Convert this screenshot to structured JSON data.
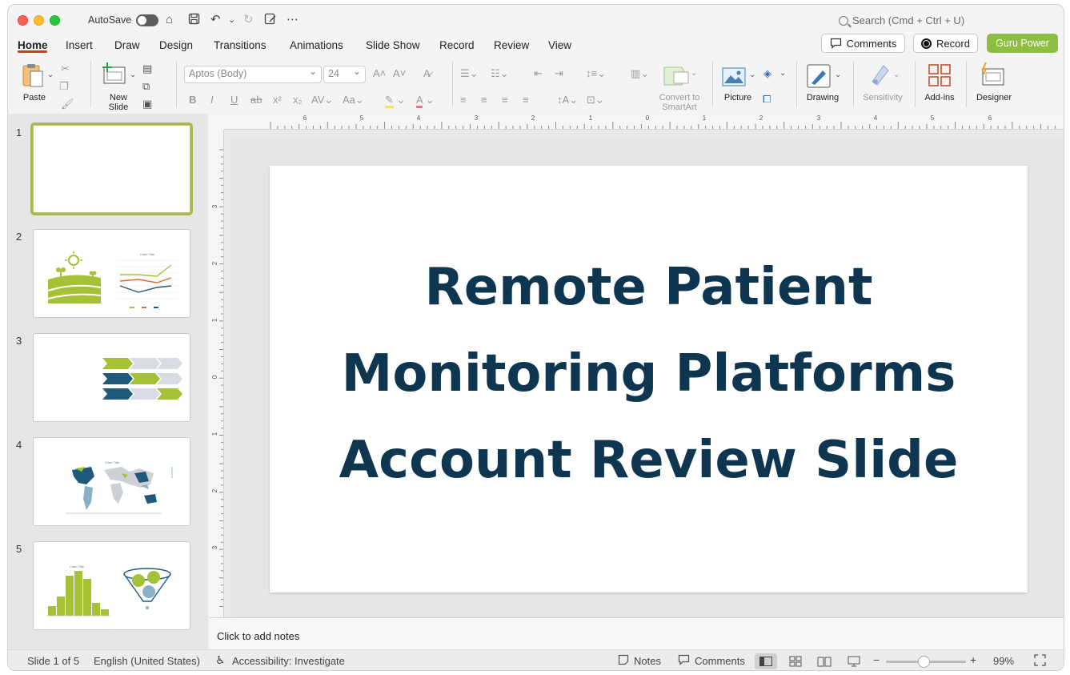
{
  "titlebar": {
    "autosave_label": "AutoSave",
    "search_placeholder": "Search (Cmd + Ctrl + U)"
  },
  "tabs": [
    {
      "label": "Home"
    },
    {
      "label": "Insert"
    },
    {
      "label": "Draw"
    },
    {
      "label": "Design"
    },
    {
      "label": "Transitions"
    },
    {
      "label": "Animations"
    },
    {
      "label": "Slide Show"
    },
    {
      "label": "Record"
    },
    {
      "label": "Review"
    },
    {
      "label": "View"
    }
  ],
  "header_buttons": {
    "comments": "Comments",
    "record": "Record",
    "guru": "Guru Power"
  },
  "ribbon": {
    "paste": "Paste",
    "new_slide_1": "New",
    "new_slide_2": "Slide",
    "font_name": "Aptos (Body)",
    "font_size": "24",
    "convert_1": "Convert to",
    "convert_2": "SmartArt",
    "picture": "Picture",
    "drawing": "Drawing",
    "sensitivity": "Sensitivity",
    "addins": "Add-ins",
    "designer": "Designer"
  },
  "ruler": {
    "top": [
      "6",
      "5",
      "4",
      "3",
      "2",
      "1",
      "0",
      "1",
      "2",
      "3",
      "4",
      "5",
      "6"
    ],
    "left": [
      "3",
      "2",
      "1",
      "0",
      "1",
      "2",
      "3"
    ]
  },
  "thumbnails": [
    {
      "number": "1"
    },
    {
      "number": "2",
      "chart_title": "Chart Title"
    },
    {
      "number": "3"
    },
    {
      "number": "4",
      "chart_title": "Chart Title"
    },
    {
      "number": "5",
      "chart_title": "Chart Title"
    }
  ],
  "slide": {
    "title_line1": "Remote Patient",
    "title_line2": "Monitoring Platforms",
    "title_line3": "Account Review Slide"
  },
  "notes": {
    "placeholder": "Click to add notes"
  },
  "status": {
    "slide_count": "Slide 1 of 5",
    "language": "English (United States)",
    "accessibility": "Accessibility: Investigate",
    "notes": "Notes",
    "comments": "Comments",
    "zoom": "99%"
  },
  "colors": {
    "accent_green": "#8cbf3f",
    "title_navy": "#0e3650",
    "tab_underline": "#c43e1c"
  }
}
